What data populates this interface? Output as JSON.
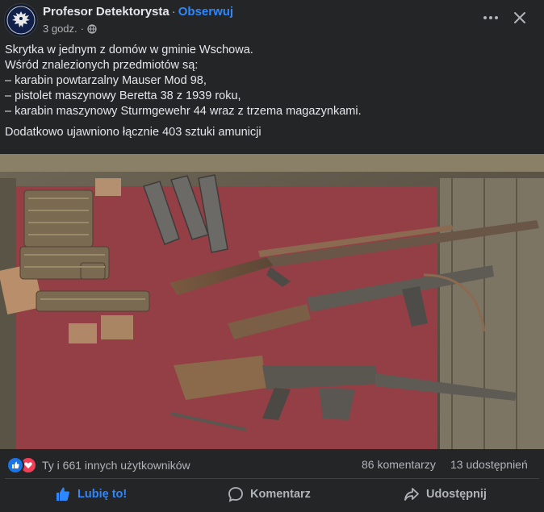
{
  "post": {
    "author": "Profesor Detektorysta",
    "separator": "·",
    "follow_label": "Obserwuj",
    "time": "3 godz.",
    "meta_separator": "·",
    "privacy_icon": "globe-icon",
    "text_lines": [
      "Skrytka w jednym z domów w gminie Wschowa.",
      "Wśród znalezionych przedmiotów są:",
      "– karabin powtarzalny Mauser Mod 98,",
      "– pistolet maszynowy Beretta 38 z 1939 roku,",
      "– karabin maszynowy Sturmgewehr 44 wraz z trzema magazynkami."
    ],
    "text_extra": "Dodatkowo ujawniono łącznie 403 sztuki amunicji"
  },
  "stats": {
    "reactions_text": "Ty i 661 innych użytkowników",
    "comments": "86 komentarzy",
    "shares": "13 udostępnień"
  },
  "actions": {
    "like": "Lubię to!",
    "comment": "Komentarz",
    "share": "Udostępnij"
  },
  "colors": {
    "background": "#242526",
    "accent": "#2d88ff",
    "text": "#e4e6eb",
    "secondary_text": "#b0b3b8",
    "like_reaction": "#1b74e4",
    "love_reaction": "#f33e58"
  }
}
